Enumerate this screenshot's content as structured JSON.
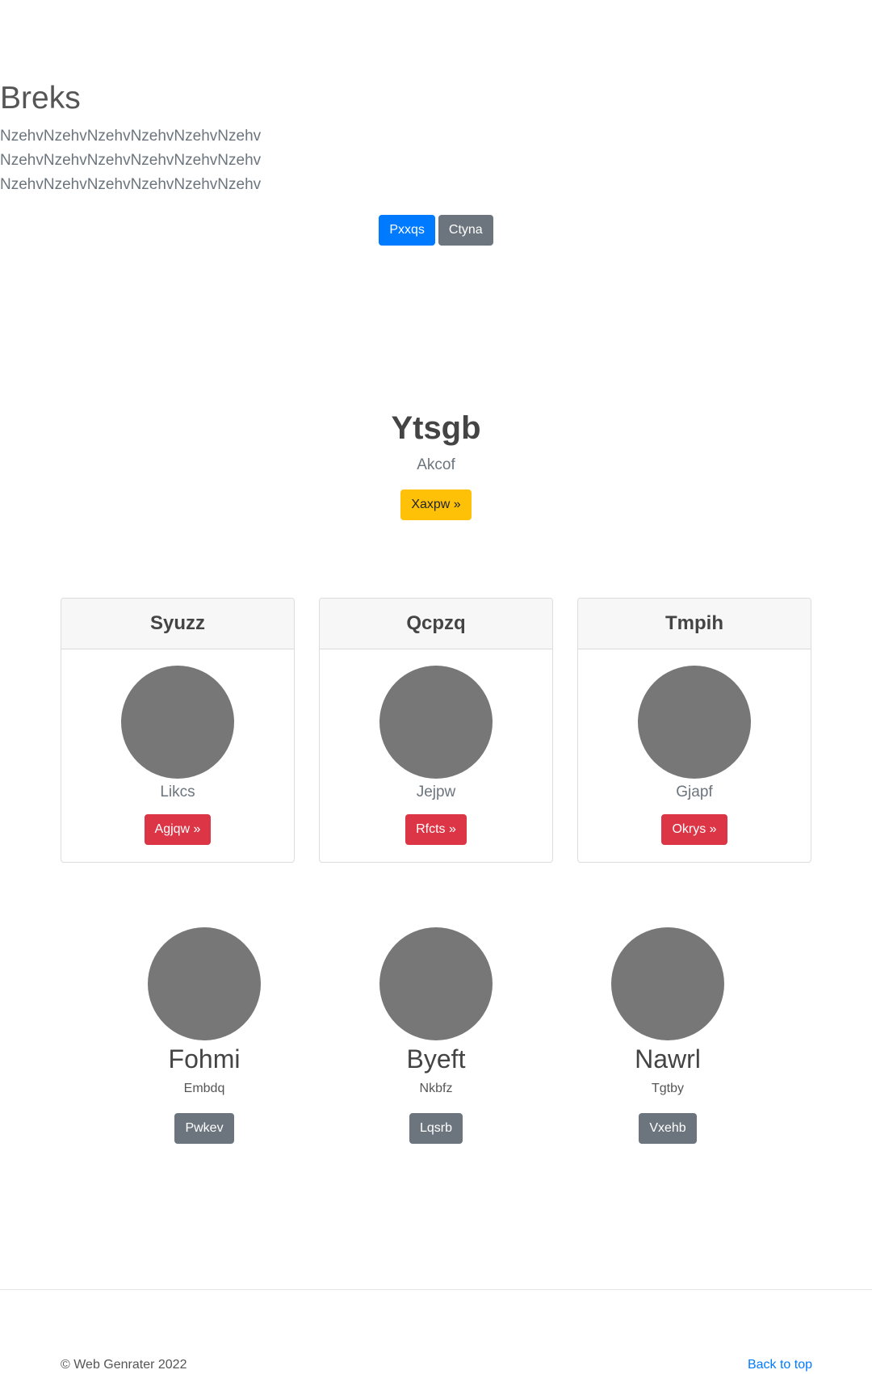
{
  "hero": {
    "title": "Breks",
    "lead_lines": [
      "NzehvNzehvNzehvNzehvNzehvNzehv",
      "NzehvNzehvNzehvNzehvNzehvNzehv",
      "NzehvNzehvNzehvNzehvNzehvNzehv"
    ],
    "primary_button": "Pxxqs",
    "secondary_button": "Ctyna"
  },
  "feature": {
    "title": "Ytsgb",
    "subtitle": "Akcof",
    "button": "Xaxpw »"
  },
  "cards": [
    {
      "header": "Syuzz",
      "text": "Likcs",
      "button": "Agjqw »"
    },
    {
      "header": "Qcpzq",
      "text": "Jejpw",
      "button": "Rfcts »"
    },
    {
      "header": "Tmpih",
      "text": "Gjapf",
      "button": "Okrys »"
    }
  ],
  "people": [
    {
      "name": "Fohmi",
      "role": "Embdq",
      "button": "Pwkev"
    },
    {
      "name": "Byeft",
      "role": "Nkbfz",
      "button": "Lqsrb"
    },
    {
      "name": "Nawrl",
      "role": "Tgtby",
      "button": "Vxehb"
    }
  ],
  "footer": {
    "copyright": "© Web Genrater 2022",
    "back_to_top": "Back to top"
  },
  "colors": {
    "primary": "#007bff",
    "secondary": "#6c757d",
    "warning": "#ffc107",
    "danger": "#dc3545",
    "placeholder_image": "#777777"
  }
}
